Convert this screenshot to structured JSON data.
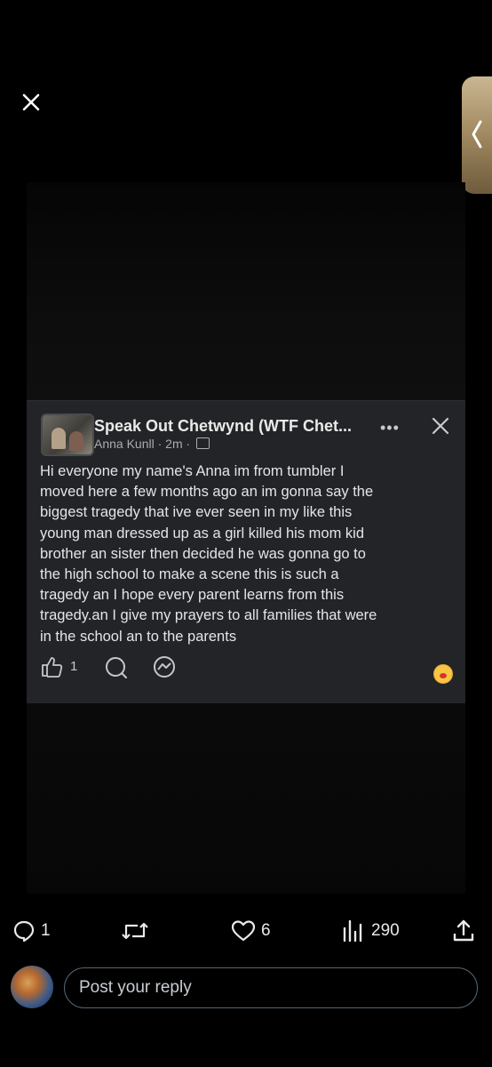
{
  "viewer": {
    "close_icon": "close-icon",
    "side_panel_icon": "chevron-left-icon"
  },
  "post": {
    "group_name": "Speak Out Chetwynd (WTF Chet...",
    "author": "Anna Kunll",
    "time": "2m",
    "separator": "·",
    "more_label": "•••",
    "body": "Hi everyone  my name's Anna im from tumbler  I\nmoved here a few months ago an im gonna say the\nbiggest  tragedy that ive ever seen in my like this\nyoung man dressed up as a girl  killed his mom kid\nbrother an sister  then decided he was gonna  go to\nthe high school to make a scene   this is such a\ntragedy  an I hope every  parent learns from this\ntragedy.an I give my prayers  to all families  that were\nin the school  an to the parents",
    "like_count": "1"
  },
  "tweet_actions": {
    "replies": "1",
    "likes": "6",
    "views": "290"
  },
  "reply": {
    "placeholder": "Post your reply"
  },
  "colors": {
    "background": "#000000",
    "card": "#232427",
    "text": "#e7e9ea",
    "input_border": "#536471"
  }
}
